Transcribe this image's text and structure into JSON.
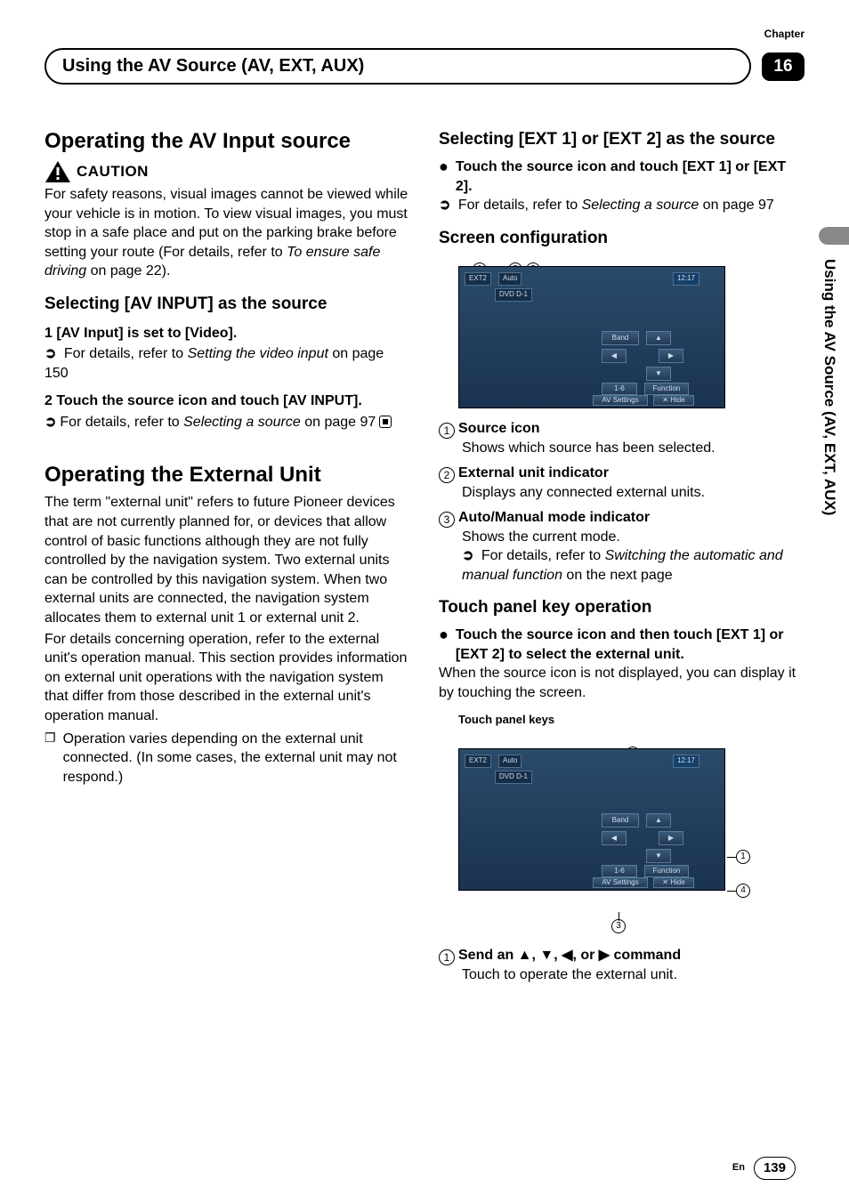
{
  "header": {
    "chapter_label": "Chapter",
    "section_title": "Using the AV Source (AV, EXT, AUX)",
    "chapter_number": "16"
  },
  "side_tab": "Using the AV Source (AV, EXT, AUX)",
  "left": {
    "h1": "Operating the AV Input source",
    "caution_label": "CAUTION",
    "caution_body": "For safety reasons, visual images cannot be viewed while your vehicle is in motion. To view visual images, you must stop in a safe place and put on the parking brake before setting your route (For details, refer to ",
    "caution_ref_italic": "To ensure safe driving",
    "caution_body_tail": " on page 22).",
    "h2a": "Selecting [AV INPUT] as the source",
    "step1": "1    [AV Input] is set to [Video].",
    "step1_ref_pre": "For details, refer to ",
    "step1_ref_italic": "Setting the video input",
    "step1_ref_tail": " on page 150",
    "step2": "2    Touch the source icon and touch [AV INPUT].",
    "step2_ref_pre": "For details, refer to ",
    "step2_ref_italic": "Selecting a source",
    "step2_ref_tail": " on page 97",
    "h1b": "Operating the External Unit",
    "ext_body": "The term \"external unit\" refers to future Pioneer devices that are not currently planned for, or devices that allow control of basic functions although they are not fully controlled by the navigation system. Two external units can be controlled by this navigation system. When two external units are connected, the navigation system allocates them to external unit 1 or external unit 2.",
    "ext_body2": "For details concerning operation, refer to the external unit's operation manual. This section provides information on external unit operations with the navigation system that differ from those described in the external unit's operation manual.",
    "ext_note": "Operation varies depending on the external unit connected. (In some cases, the external unit may not respond.)"
  },
  "right": {
    "h2a": "Selecting [EXT 1] or [EXT 2] as the source",
    "bullet1": "Touch the source icon and touch [EXT 1] or [EXT 2].",
    "bullet1_ref_pre": "For details, refer to ",
    "bullet1_ref_italic": "Selecting a source",
    "bullet1_ref_tail": " on page 97",
    "h2b": "Screen configuration",
    "screen1": {
      "src_label": "EXT2",
      "mode": "Auto",
      "time": "12:17",
      "dvd": "DVD D-1",
      "band": "Band",
      "n16": "1-6",
      "func": "Function",
      "avs": "AV Settings",
      "hide": "Hide"
    },
    "cfg1_t": "Source icon",
    "cfg1_d": "Shows which source has been selected.",
    "cfg2_t": "External unit indicator",
    "cfg2_d": "Displays any connected external units.",
    "cfg3_t": "Auto/Manual mode indicator",
    "cfg3_d": "Shows the current mode.",
    "cfg3_ref_pre": "For details, refer to ",
    "cfg3_ref_italic": "Switching the automatic and manual function",
    "cfg3_ref_tail": " on the next page",
    "h2c": "Touch panel key operation",
    "tp_bullet": "Touch the source icon and then touch [EXT 1] or [EXT 2] to select the external unit.",
    "tp_body": "When the source icon is not displayed, you can display it by touching the screen.",
    "tpk_heading": "Touch panel keys",
    "cmd1_t": "Send an ▲, ▼, ◀, or ▶ command",
    "cmd1_d": "Touch to operate the external unit."
  },
  "footer": {
    "lang": "En",
    "page": "139"
  }
}
